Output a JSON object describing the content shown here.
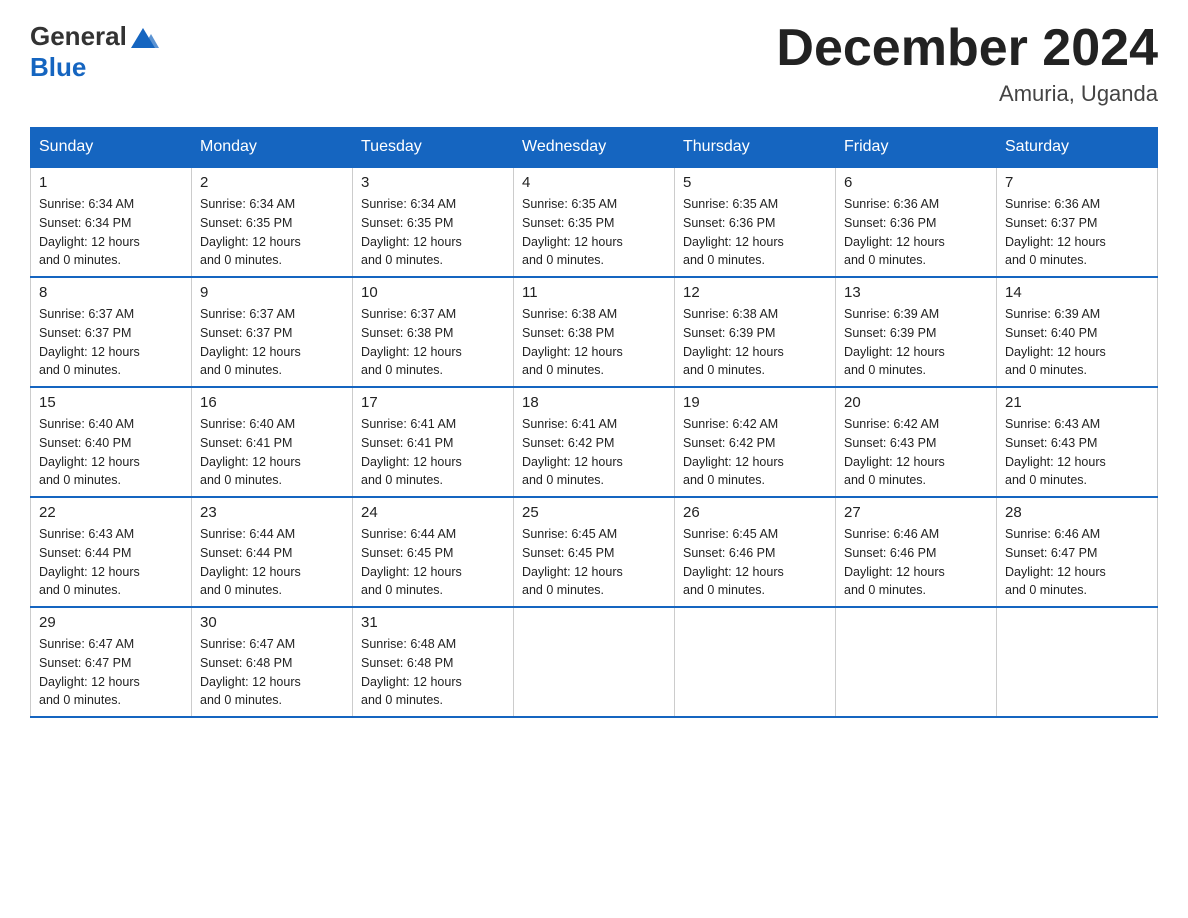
{
  "header": {
    "logo_general": "General",
    "logo_blue": "Blue",
    "month_year": "December 2024",
    "location": "Amuria, Uganda"
  },
  "days_of_week": [
    "Sunday",
    "Monday",
    "Tuesday",
    "Wednesday",
    "Thursday",
    "Friday",
    "Saturday"
  ],
  "weeks": [
    [
      {
        "day": "1",
        "sunrise": "6:34 AM",
        "sunset": "6:34 PM",
        "daylight": "12 hours and 0 minutes."
      },
      {
        "day": "2",
        "sunrise": "6:34 AM",
        "sunset": "6:35 PM",
        "daylight": "12 hours and 0 minutes."
      },
      {
        "day": "3",
        "sunrise": "6:34 AM",
        "sunset": "6:35 PM",
        "daylight": "12 hours and 0 minutes."
      },
      {
        "day": "4",
        "sunrise": "6:35 AM",
        "sunset": "6:35 PM",
        "daylight": "12 hours and 0 minutes."
      },
      {
        "day": "5",
        "sunrise": "6:35 AM",
        "sunset": "6:36 PM",
        "daylight": "12 hours and 0 minutes."
      },
      {
        "day": "6",
        "sunrise": "6:36 AM",
        "sunset": "6:36 PM",
        "daylight": "12 hours and 0 minutes."
      },
      {
        "day": "7",
        "sunrise": "6:36 AM",
        "sunset": "6:37 PM",
        "daylight": "12 hours and 0 minutes."
      }
    ],
    [
      {
        "day": "8",
        "sunrise": "6:37 AM",
        "sunset": "6:37 PM",
        "daylight": "12 hours and 0 minutes."
      },
      {
        "day": "9",
        "sunrise": "6:37 AM",
        "sunset": "6:37 PM",
        "daylight": "12 hours and 0 minutes."
      },
      {
        "day": "10",
        "sunrise": "6:37 AM",
        "sunset": "6:38 PM",
        "daylight": "12 hours and 0 minutes."
      },
      {
        "day": "11",
        "sunrise": "6:38 AM",
        "sunset": "6:38 PM",
        "daylight": "12 hours and 0 minutes."
      },
      {
        "day": "12",
        "sunrise": "6:38 AM",
        "sunset": "6:39 PM",
        "daylight": "12 hours and 0 minutes."
      },
      {
        "day": "13",
        "sunrise": "6:39 AM",
        "sunset": "6:39 PM",
        "daylight": "12 hours and 0 minutes."
      },
      {
        "day": "14",
        "sunrise": "6:39 AM",
        "sunset": "6:40 PM",
        "daylight": "12 hours and 0 minutes."
      }
    ],
    [
      {
        "day": "15",
        "sunrise": "6:40 AM",
        "sunset": "6:40 PM",
        "daylight": "12 hours and 0 minutes."
      },
      {
        "day": "16",
        "sunrise": "6:40 AM",
        "sunset": "6:41 PM",
        "daylight": "12 hours and 0 minutes."
      },
      {
        "day": "17",
        "sunrise": "6:41 AM",
        "sunset": "6:41 PM",
        "daylight": "12 hours and 0 minutes."
      },
      {
        "day": "18",
        "sunrise": "6:41 AM",
        "sunset": "6:42 PM",
        "daylight": "12 hours and 0 minutes."
      },
      {
        "day": "19",
        "sunrise": "6:42 AM",
        "sunset": "6:42 PM",
        "daylight": "12 hours and 0 minutes."
      },
      {
        "day": "20",
        "sunrise": "6:42 AM",
        "sunset": "6:43 PM",
        "daylight": "12 hours and 0 minutes."
      },
      {
        "day": "21",
        "sunrise": "6:43 AM",
        "sunset": "6:43 PM",
        "daylight": "12 hours and 0 minutes."
      }
    ],
    [
      {
        "day": "22",
        "sunrise": "6:43 AM",
        "sunset": "6:44 PM",
        "daylight": "12 hours and 0 minutes."
      },
      {
        "day": "23",
        "sunrise": "6:44 AM",
        "sunset": "6:44 PM",
        "daylight": "12 hours and 0 minutes."
      },
      {
        "day": "24",
        "sunrise": "6:44 AM",
        "sunset": "6:45 PM",
        "daylight": "12 hours and 0 minutes."
      },
      {
        "day": "25",
        "sunrise": "6:45 AM",
        "sunset": "6:45 PM",
        "daylight": "12 hours and 0 minutes."
      },
      {
        "day": "26",
        "sunrise": "6:45 AM",
        "sunset": "6:46 PM",
        "daylight": "12 hours and 0 minutes."
      },
      {
        "day": "27",
        "sunrise": "6:46 AM",
        "sunset": "6:46 PM",
        "daylight": "12 hours and 0 minutes."
      },
      {
        "day": "28",
        "sunrise": "6:46 AM",
        "sunset": "6:47 PM",
        "daylight": "12 hours and 0 minutes."
      }
    ],
    [
      {
        "day": "29",
        "sunrise": "6:47 AM",
        "sunset": "6:47 PM",
        "daylight": "12 hours and 0 minutes."
      },
      {
        "day": "30",
        "sunrise": "6:47 AM",
        "sunset": "6:48 PM",
        "daylight": "12 hours and 0 minutes."
      },
      {
        "day": "31",
        "sunrise": "6:48 AM",
        "sunset": "6:48 PM",
        "daylight": "12 hours and 0 minutes."
      },
      null,
      null,
      null,
      null
    ]
  ],
  "labels": {
    "sunrise": "Sunrise:",
    "sunset": "Sunset:",
    "daylight": "Daylight:"
  }
}
